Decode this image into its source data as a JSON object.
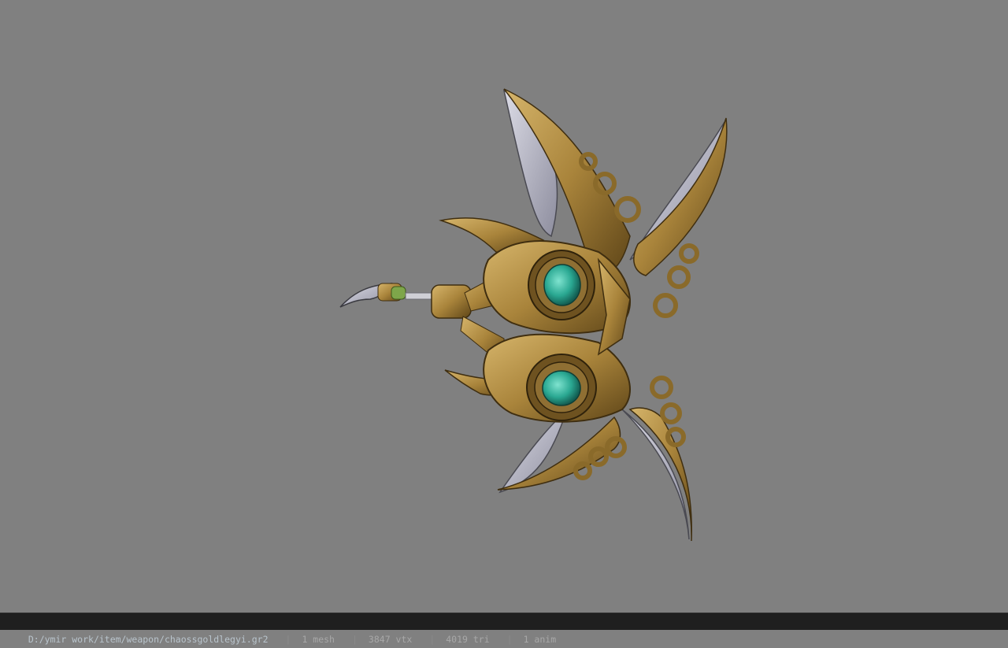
{
  "viewport": {
    "background": "#808080",
    "model_name": "chaossgoldlegyi",
    "colors": {
      "gold": "#b08a3e",
      "gold_dark": "#5e4518",
      "blade": "#b9b9c6",
      "gem": "#2fb39b"
    }
  },
  "statusbar": {
    "path": "D:/ymir work/item/weapon/chaossgoldlegyi.gr2",
    "separator": "|",
    "mesh": "1 mesh",
    "vtx": "3847 vtx",
    "tri": "4019 tri",
    "anim": "1 anim"
  }
}
